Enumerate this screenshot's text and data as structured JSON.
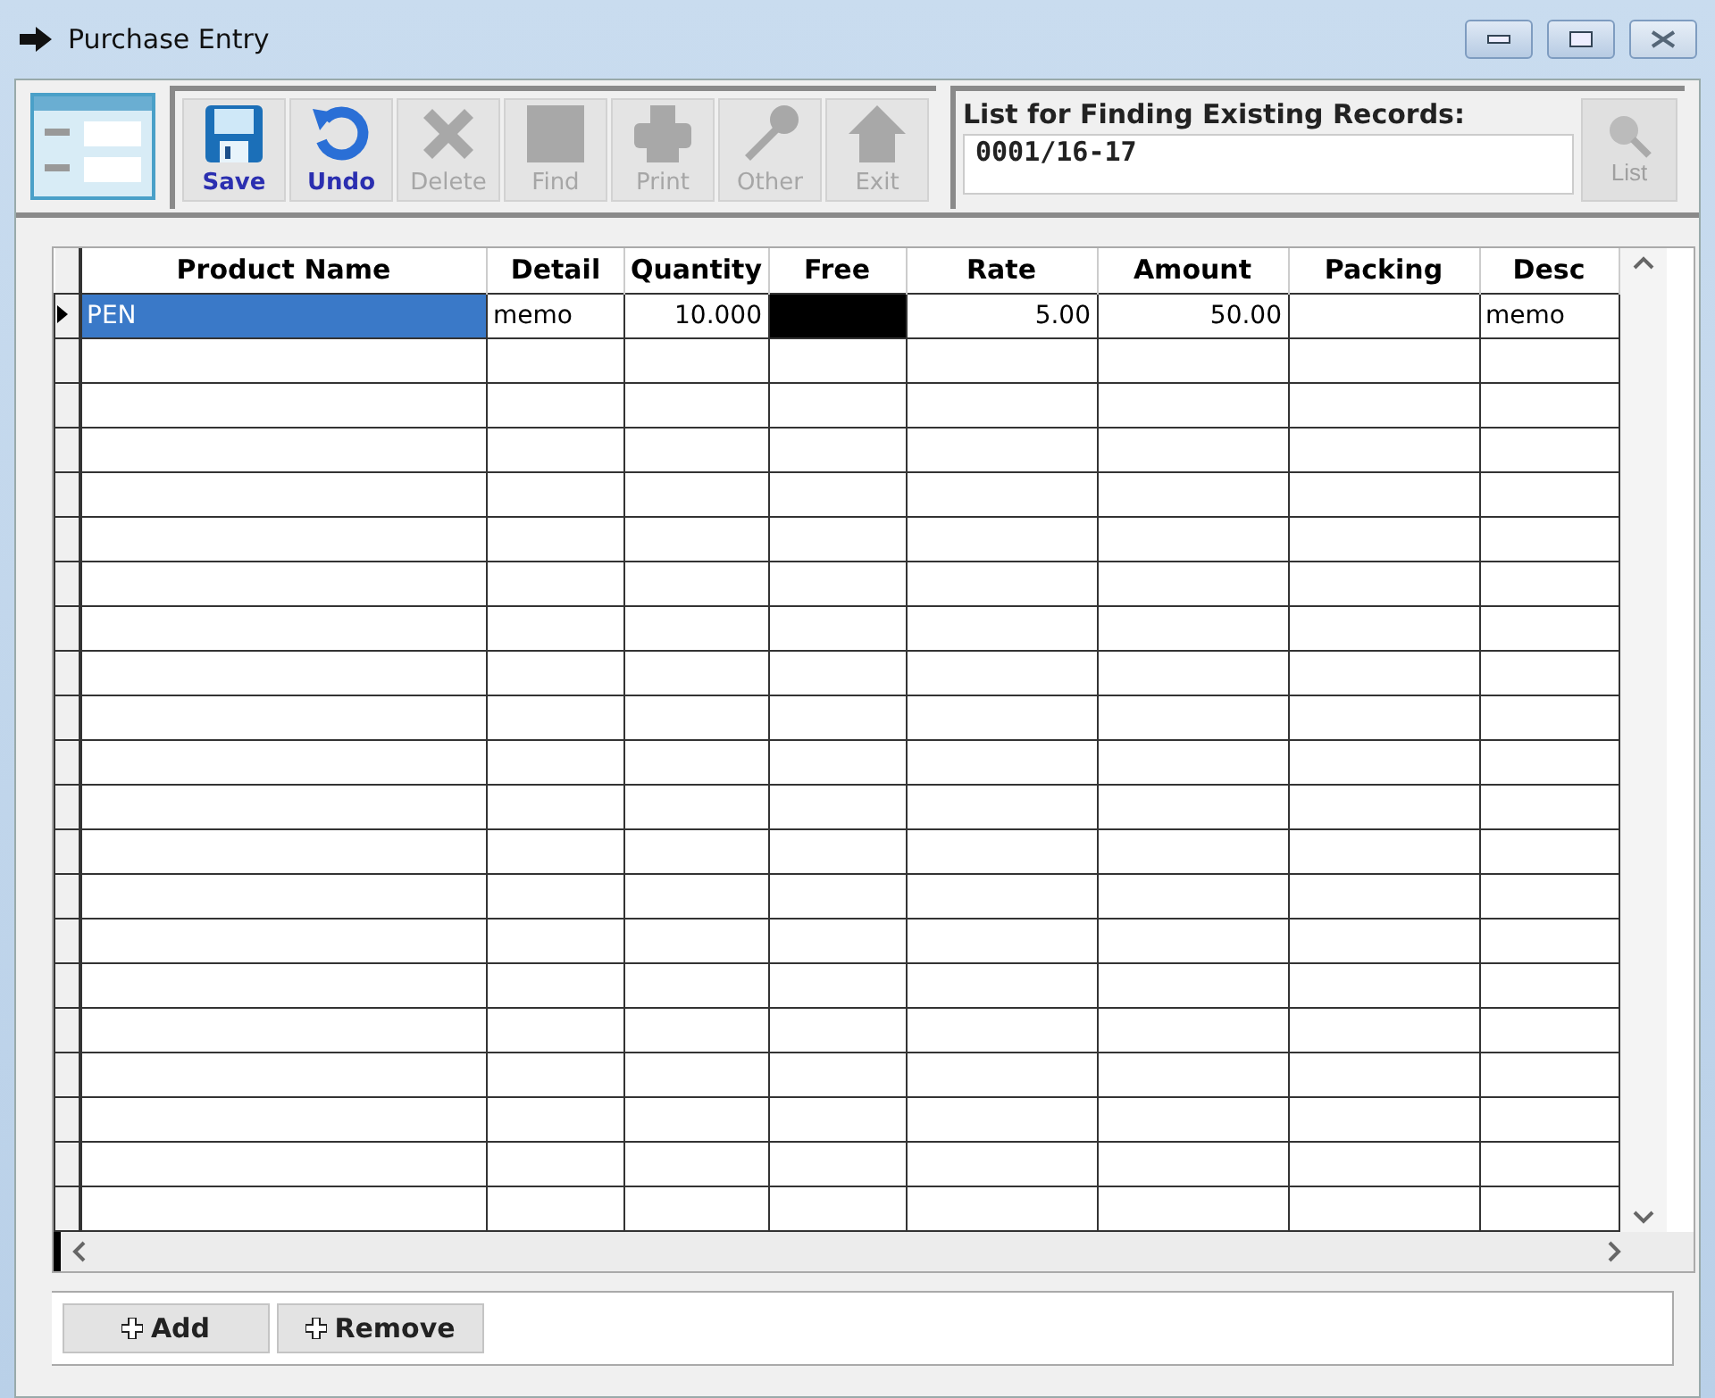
{
  "window": {
    "title": "Purchase Entry"
  },
  "toolbar": [
    {
      "label": "Save",
      "kind": "save",
      "disabled": false
    },
    {
      "label": "Undo",
      "kind": "undo",
      "disabled": false
    },
    {
      "label": "Delete",
      "kind": "delete",
      "disabled": true
    },
    {
      "label": "Find",
      "kind": "find",
      "disabled": true
    },
    {
      "label": "Print",
      "kind": "print",
      "disabled": true
    },
    {
      "label": "Other",
      "kind": "other",
      "disabled": true
    },
    {
      "label": "Exit",
      "kind": "exit",
      "disabled": true
    }
  ],
  "record_finder": {
    "label": "List for Finding Existing Records:",
    "value": "0001/16-17",
    "list_button": {
      "label": "List",
      "disabled": true
    }
  },
  "grid": {
    "columns": [
      {
        "label": "Product Name"
      },
      {
        "label": "Detail"
      },
      {
        "label": "Quantity"
      },
      {
        "label": "Free"
      },
      {
        "label": "Rate"
      },
      {
        "label": "Amount"
      },
      {
        "label": "Packing"
      },
      {
        "label": "Desc"
      }
    ],
    "rows": [
      {
        "current": true,
        "cells": [
          {
            "text": "PEN",
            "highlighted": true,
            "editing": false
          },
          {
            "text": "memo",
            "highlighted": false,
            "editing": false
          },
          {
            "text": "10.000",
            "highlighted": false,
            "editing": false
          },
          {
            "highlighted": false,
            "editing": true
          },
          {
            "text": "5.00",
            "highlighted": false,
            "editing": false
          },
          {
            "text": "50.00",
            "highlighted": false,
            "editing": false
          },
          {
            "highlighted": false,
            "editing": false
          },
          {
            "text": "memo",
            "highlighted": false,
            "editing": false
          }
        ]
      }
    ]
  },
  "buttons": [
    {
      "label": "Add"
    },
    {
      "label": "Remove"
    }
  ]
}
